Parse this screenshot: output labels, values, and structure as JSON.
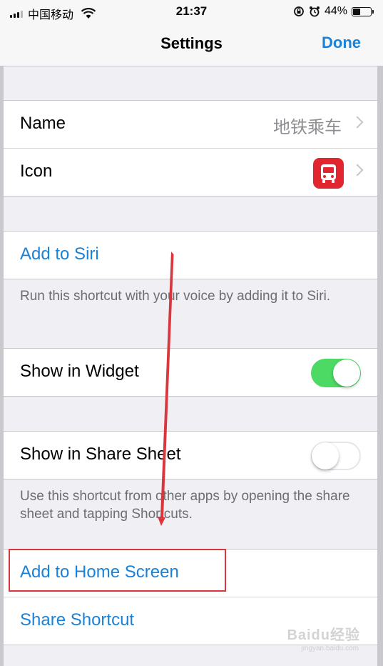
{
  "status_bar": {
    "carrier": "中国移动",
    "time": "21:37",
    "battery_percent": "44%",
    "battery_level": 0.44
  },
  "nav": {
    "title": "Settings",
    "done_label": "Done"
  },
  "name_row": {
    "label": "Name",
    "value": "地铁乘车"
  },
  "icon_row": {
    "label": "Icon",
    "icon": "bus-icon",
    "icon_color": "#e1262f"
  },
  "siri": {
    "label": "Add to Siri",
    "footer": "Run this shortcut with your voice by adding it to Siri."
  },
  "widget": {
    "label": "Show in Widget",
    "enabled": true
  },
  "share_sheet": {
    "label": "Show in Share Sheet",
    "enabled": false,
    "footer": "Use this shortcut from other apps by opening the share sheet and tapping Shortcuts."
  },
  "actions": {
    "home_screen_label": "Add to Home Screen",
    "share_label": "Share Shortcut"
  },
  "watermark": {
    "text": "Baidu经验",
    "sub": "jingyan.baidu.com"
  },
  "colors": {
    "accent": "#1a82d8",
    "toggle_on": "#4cd964",
    "annotation": "#d9373d"
  }
}
